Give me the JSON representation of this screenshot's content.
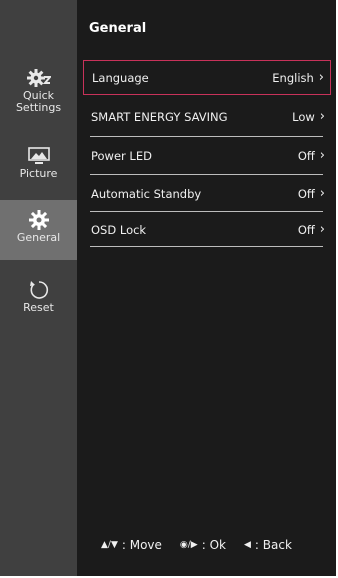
{
  "sidebar": {
    "items": [
      {
        "label_line1": "Quick",
        "label_line2": "Settings",
        "icon": "quick-settings-icon"
      },
      {
        "label": "Picture",
        "icon": "picture-icon"
      },
      {
        "label": "General",
        "icon": "gear-icon",
        "active": true
      },
      {
        "label": "Reset",
        "icon": "reset-icon"
      }
    ]
  },
  "main": {
    "title": "General",
    "rows": [
      {
        "label": "Language",
        "value": "English"
      },
      {
        "label": "SMART ENERGY SAVING",
        "value": "Low"
      },
      {
        "label": "Power LED",
        "value": "Off"
      },
      {
        "label": "Automatic Standby",
        "value": "Off"
      },
      {
        "label": "OSD Lock",
        "value": "Off"
      }
    ]
  },
  "footer": {
    "move_label": ": Move",
    "ok_label": ": Ok",
    "back_label": ": Back"
  },
  "colors": {
    "background": "#1b1b1b",
    "sidebar": "#404040",
    "sidebar_active": "#707070",
    "selection_border": "#c8325a"
  }
}
